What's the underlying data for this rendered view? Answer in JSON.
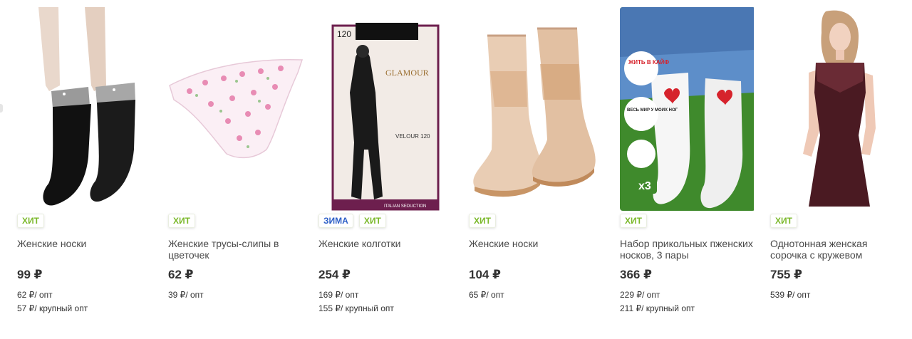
{
  "products": [
    {
      "badges": [
        "ХИТ"
      ],
      "name": "Женские носки",
      "price": "99 ₽",
      "opt": "62 ₽/ опт",
      "bulk": "57 ₽/ крупный опт"
    },
    {
      "badges": [
        "ХИТ"
      ],
      "name": "Женские трусы-слипы в цветочек",
      "price": "62 ₽",
      "opt": "39 ₽/ опт",
      "bulk": ""
    },
    {
      "badges": [
        "ЗИМА",
        "ХИТ"
      ],
      "name": "Женские колготки",
      "price": "254 ₽",
      "opt": "169 ₽/ опт",
      "bulk": "155 ₽/ крупный опт",
      "package": {
        "density": "120",
        "brand": "GLAMOUR",
        "model": "VELOUR 120",
        "tagline": "ITALIAN SEDUCTION"
      }
    },
    {
      "badges": [
        "ХИТ"
      ],
      "name": "Женские носки",
      "price": "104 ₽",
      "opt": "65 ₽/ опт",
      "bulk": ""
    },
    {
      "badges": [
        "ХИТ"
      ],
      "name": "Набор прикольных пженских носков, 3 пары",
      "price": "366 ₽",
      "opt": "229 ₽/ опт",
      "bulk": "211 ₽/ крупный опт",
      "image_text": {
        "circle1": "ЖИТЬ В КАЙФ",
        "circle2": "ВЕСЬ МИР У МОИХ НОГ",
        "pack": "x3"
      }
    },
    {
      "badges": [
        "ХИТ"
      ],
      "name": "Однотонная женская сорочка с кружевом",
      "price": "755 ₽",
      "opt": "539 ₽/ опт",
      "bulk": ""
    }
  ],
  "colors": {
    "hit_badge": "#7ab829",
    "zima_badge": "#2d5fc7",
    "grass": "#3f8a2c"
  }
}
